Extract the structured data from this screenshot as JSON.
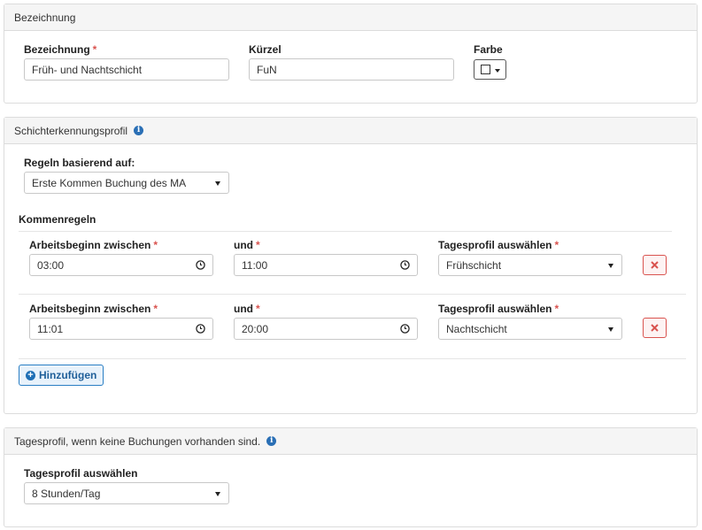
{
  "bezeichnung_panel": {
    "heading": "Bezeichnung",
    "name_label": "Bezeichnung",
    "name_value": "Früh- und Nachtschicht",
    "short_label": "Kürzel",
    "short_value": "FuN",
    "color_label": "Farbe",
    "required_mark": "*"
  },
  "shift_panel": {
    "heading": "Schichterkennungsprofil",
    "rules_based_label": "Regeln basierend auf:",
    "rules_based_value": "Erste Kommen Buchung des MA",
    "kommen_heading": "Kommenregeln",
    "rules": [
      {
        "start_label": "Arbeitsbeginn zwischen",
        "start_value": "03:00",
        "end_label": "und",
        "end_value": "11:00",
        "profile_label": "Tagesprofil auswählen",
        "profile_value": "Frühschicht"
      },
      {
        "start_label": "Arbeitsbeginn zwischen",
        "start_value": "11:01",
        "end_label": "und",
        "end_value": "20:00",
        "profile_label": "Tagesprofil auswählen",
        "profile_value": "Nachtschicht"
      }
    ],
    "add_label": "Hinzufügen"
  },
  "no_booking_panel": {
    "heading": "Tagesprofil, wenn keine Buchungen vorhanden sind.",
    "profile_label": "Tagesprofil auswählen",
    "profile_value": "8 Stunden/Tag"
  },
  "colors": {
    "required": "#d9534f",
    "accent": "#2a6fb5",
    "danger": "#d9534f"
  }
}
